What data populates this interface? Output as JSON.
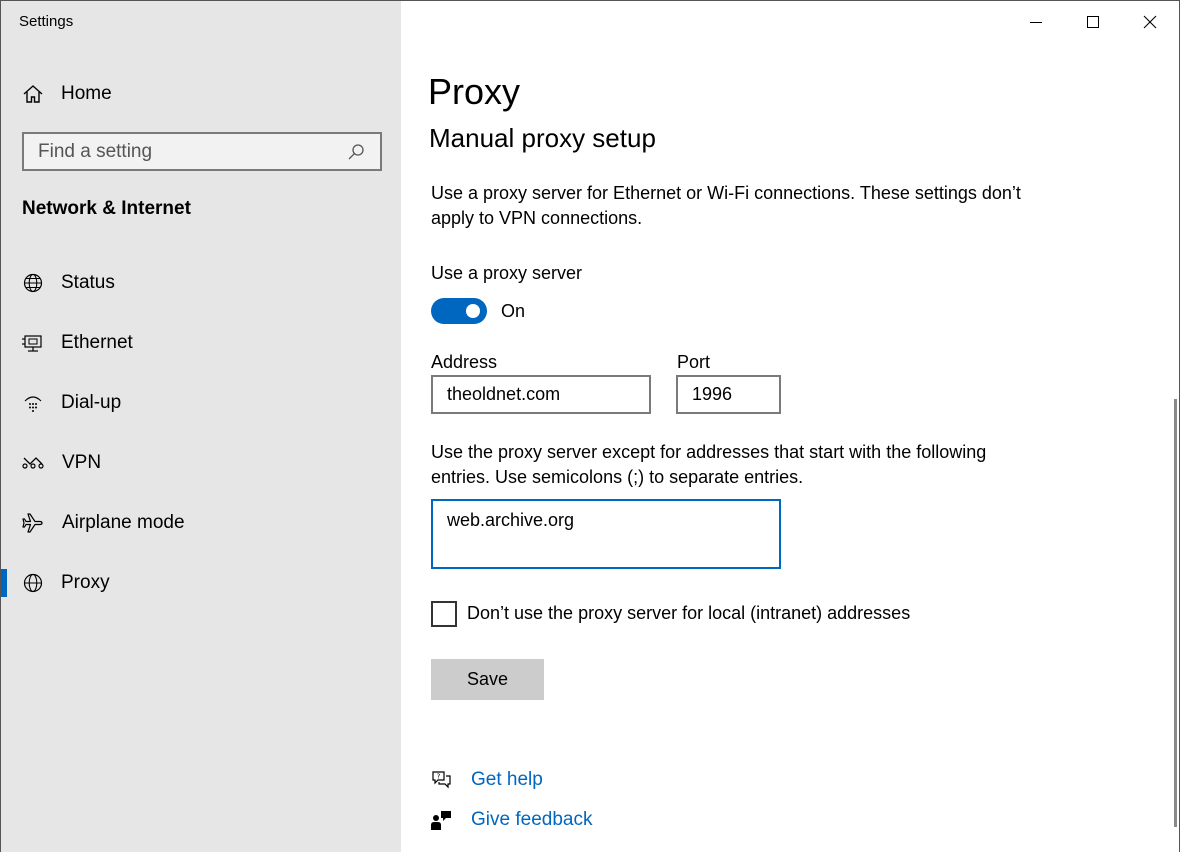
{
  "window": {
    "app_title": "Settings"
  },
  "sidebar": {
    "home_label": "Home",
    "search_placeholder": "Find a setting",
    "section_title": "Network & Internet",
    "items": [
      {
        "label": "Status",
        "icon": "globe-icon"
      },
      {
        "label": "Ethernet",
        "icon": "ethernet-icon"
      },
      {
        "label": "Dial-up",
        "icon": "dial-up-icon"
      },
      {
        "label": "VPN",
        "icon": "vpn-icon"
      },
      {
        "label": "Airplane mode",
        "icon": "airplane-icon"
      },
      {
        "label": "Proxy",
        "icon": "globe-icon",
        "selected": true
      }
    ]
  },
  "main": {
    "page_title": "Proxy",
    "section_title": "Manual proxy setup",
    "description": "Use a proxy server for Ethernet or Wi-Fi connections. These settings don’t apply to VPN connections.",
    "use_proxy_label": "Use a proxy server",
    "toggle_state": "On",
    "address_label": "Address",
    "address_value": "theoldnet.com",
    "port_label": "Port",
    "port_value": "1996",
    "exceptions_description": "Use the proxy server except for addresses that start with the following entries. Use semicolons (;) to separate entries.",
    "exceptions_value": "web.archive.org",
    "local_checkbox_label": "Don’t use the proxy server for local (intranet) addresses",
    "local_checkbox_checked": false,
    "save_label": "Save",
    "help_label": "Get help",
    "feedback_label": "Give feedback"
  },
  "colors": {
    "accent": "#0067c0",
    "sidebar_bg": "#e6e6e6",
    "button_bg": "#cccccc"
  }
}
